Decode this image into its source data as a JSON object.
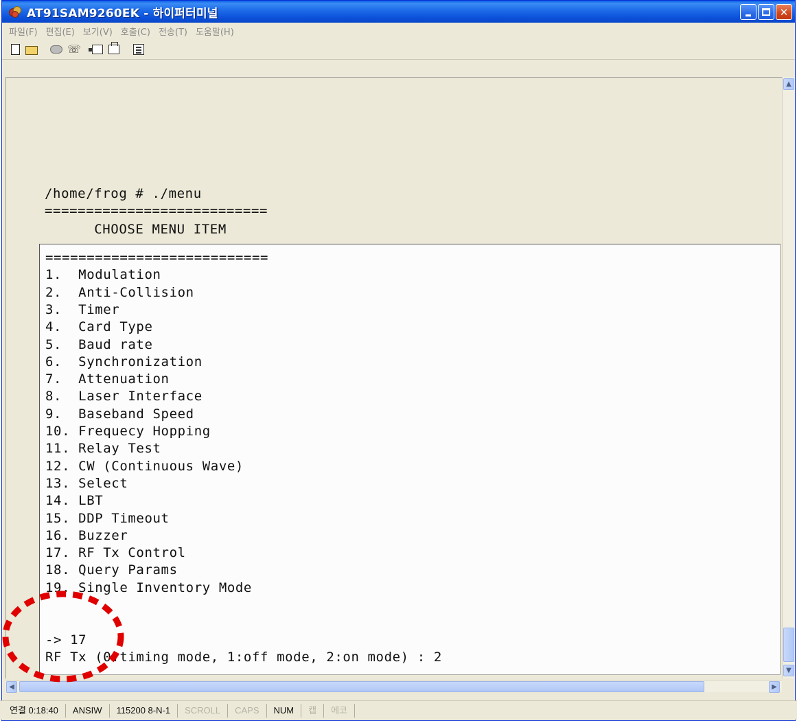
{
  "window": {
    "title": "AT91SAM9260EK - 하이퍼터미널"
  },
  "menubar": {
    "items": [
      "파일(F)",
      "편집(E)",
      "보기(V)",
      "호출(C)",
      "전송(T)",
      "도움말(H)"
    ]
  },
  "toolbar": {
    "icons": [
      "new-icon",
      "open-icon",
      "call-icon",
      "disconnect-icon",
      "send-icon",
      "receive-icon",
      "properties-icon"
    ]
  },
  "terminal": {
    "upper_lines": [
      "/home/frog # ./menu",
      "===========================",
      "      CHOOSE MENU ITEM"
    ],
    "lower_lines": [
      "===========================",
      "1.  Modulation",
      "2.  Anti-Collision",
      "3.  Timer",
      "4.  Card Type",
      "5.  Baud rate",
      "6.  Synchronization",
      "7.  Attenuation",
      "8.  Laser Interface",
      "9.  Baseband Speed",
      "10. Frequecy Hopping",
      "11. Relay Test",
      "12. CW (Continuous Wave)",
      "13. Select",
      "14. LBT",
      "15. DDP Timeout",
      "16. Buzzer",
      "17. RF Tx Control",
      "18. Query Params",
      "19. Single Inventory Mode",
      "",
      "",
      "-> 17",
      "RF Tx (0:timing mode, 1:off mode, 2:on mode) : 2"
    ]
  },
  "statusbar": {
    "connected": "연결 0:18:40",
    "emulation": "ANSIW",
    "port_settings": "115200 8-N-1",
    "scroll": "SCROLL",
    "caps": "CAPS",
    "num": "NUM",
    "capture": "캡",
    "echo": "에코"
  },
  "colors": {
    "titlebar": "#0a5fe4",
    "annotation": "#e00000",
    "terminal_bg": "#fcfcfc"
  }
}
